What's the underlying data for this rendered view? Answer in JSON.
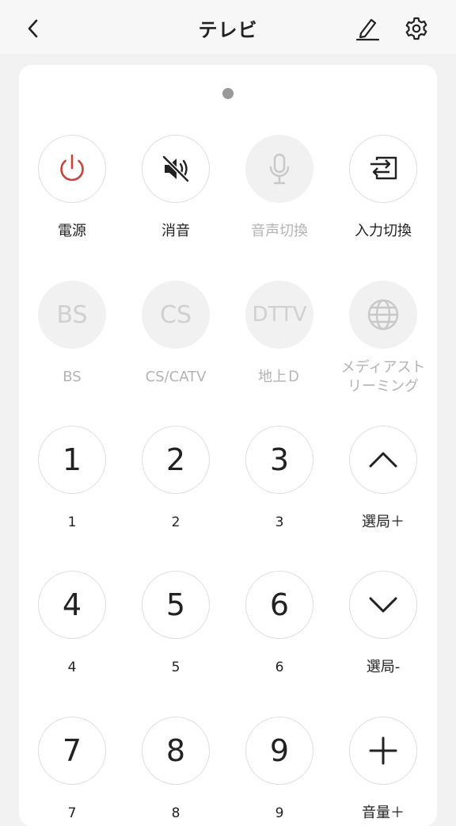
{
  "header": {
    "title": "テレビ"
  },
  "keys": {
    "power": "電源",
    "mute": "消音",
    "voice": "音声切換",
    "input": "入力切換",
    "bs_face": "BS",
    "bs": "BS",
    "cs_face": "CS",
    "cs": "CS/CATV",
    "dttv_face": "DTTV",
    "dttv": "地上Ｄ",
    "media_line1": "メディアスト",
    "media_line2": "リーミング",
    "n1": "1",
    "n2": "2",
    "n3": "3",
    "n4": "4",
    "n5": "5",
    "n6": "6",
    "n7": "7",
    "n8": "8",
    "n9": "9",
    "ch_up": "選局＋",
    "ch_down": "選局-",
    "vol_up": "音量＋"
  },
  "colors": {
    "power_icon": "#c8443a",
    "disabled": "#c8c8c8"
  }
}
